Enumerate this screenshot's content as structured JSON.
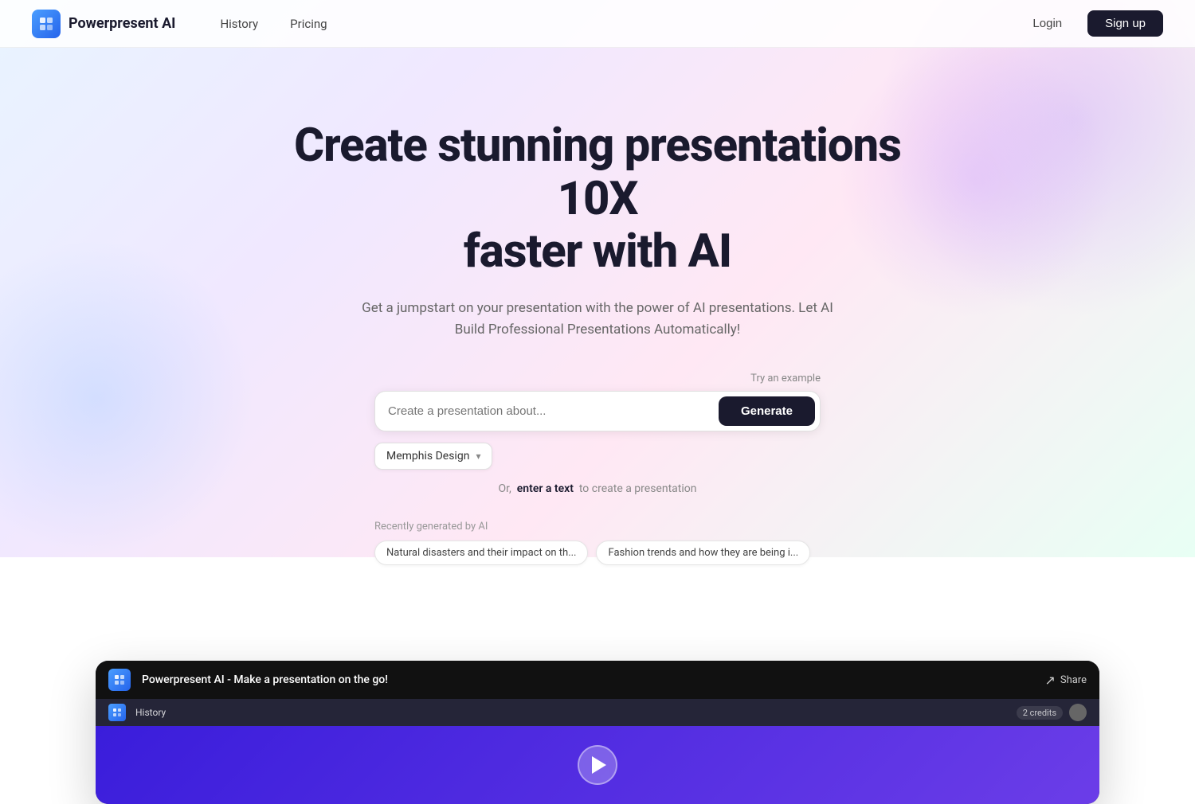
{
  "nav": {
    "logo_text": "Powerpresent AI",
    "links": [
      {
        "label": "History",
        "id": "history"
      },
      {
        "label": "Pricing",
        "id": "pricing"
      }
    ],
    "login_label": "Login",
    "signup_label": "Sign up"
  },
  "hero": {
    "title_line1": "Create stunning presentations 10X",
    "title_line2": "faster with AI",
    "subtitle": "Get a jumpstart on your presentation with the power of AI presentations. Let AI Build Professional Presentations Automatically!"
  },
  "input_section": {
    "try_example_label": "Try an example",
    "placeholder": "Create a presentation about...",
    "generate_label": "Generate",
    "style_label": "Memphis Design",
    "or_text_prefix": "Or,",
    "or_text_action": "enter a text",
    "or_text_suffix": "to create a presentation"
  },
  "recently": {
    "label": "Recently generated by AI",
    "chips": [
      {
        "text": "Natural disasters and their impact on th..."
      },
      {
        "text": "Fashion trends and how they are being i..."
      }
    ]
  },
  "video": {
    "topbar_title": "Powerpresent AI - Make a presentation on the go!",
    "share_label": "Share",
    "credits_label": "2 credits",
    "inner_history": "History"
  }
}
